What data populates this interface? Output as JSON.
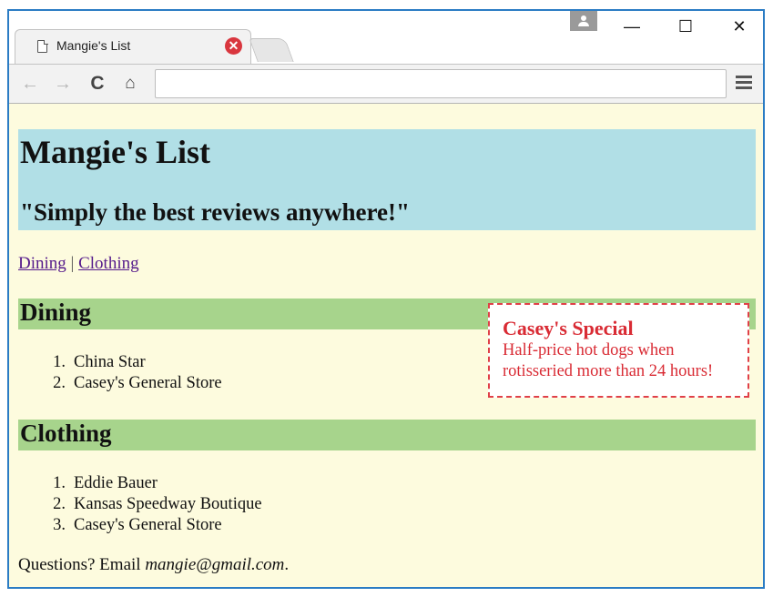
{
  "browser": {
    "tab_title": "Mangie's List",
    "tab_close_glyph": "✕",
    "address_value": "",
    "buttons": {
      "back": "←",
      "forward": "→",
      "reload": "C",
      "home": "⌂",
      "minimize": "—",
      "maximize": "☐",
      "close": "✕"
    }
  },
  "page": {
    "title": "Mangie's List",
    "tagline": "\"Simply the best reviews anywhere!\"",
    "nav": {
      "links": [
        "Dining",
        "Clothing"
      ],
      "separator": "|"
    },
    "sections": [
      {
        "heading": "Dining",
        "items": [
          "China Star",
          "Casey's General Store"
        ]
      },
      {
        "heading": "Clothing",
        "items": [
          "Eddie Bauer",
          "Kansas Speedway Boutique",
          "Casey's General Store"
        ]
      }
    ],
    "special": {
      "title": "Casey's Special",
      "body": "Half-price hot dogs when rotisseried more than 24 hours!"
    },
    "footer": {
      "prefix": "Questions? Email ",
      "email": "mangie@gmail.com",
      "suffix": "."
    },
    "numbers": [
      "1.",
      "2.",
      "3."
    ]
  },
  "colors": {
    "header_bg": "#b1dfe6",
    "section_bg": "#a7d48c",
    "page_bg": "#fdfbde",
    "special_text": "#d92b34",
    "window_border": "#2b7cc4"
  }
}
